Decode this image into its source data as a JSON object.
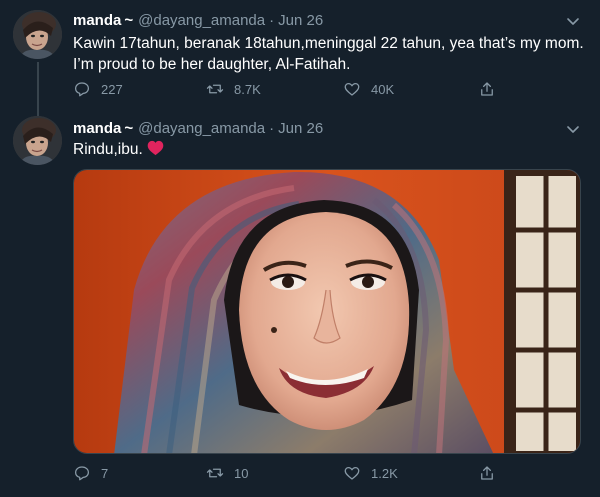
{
  "tweets": [
    {
      "name": "manda",
      "tilde": "~",
      "handle": "@dayang_amanda",
      "separator": "·",
      "time": "Jun 26",
      "text_line1": "Kawin 17tahun, beranak 18tahun,meninggal 22 tahun, yea that’s my mom.",
      "text_line2": "I’m proud to be her daughter, Al-Fatihah.",
      "replies": "227",
      "retweets": "8.7K",
      "likes": "40K"
    },
    {
      "name": "manda",
      "tilde": "~",
      "handle": "@dayang_amanda",
      "separator": "·",
      "time": "Jun 26",
      "text_line1": "Rindu,ibu.",
      "replies": "7",
      "retweets": "10",
      "likes": "1.2K"
    }
  ],
  "colors": {
    "background": "#15202b",
    "secondary_text": "#8899a6",
    "thread_line": "#38444d",
    "heart": "#e0245e"
  },
  "icons": [
    "reply-icon",
    "retweet-icon",
    "like-icon",
    "share-icon",
    "chevron-down-icon",
    "red-heart-emoji"
  ]
}
